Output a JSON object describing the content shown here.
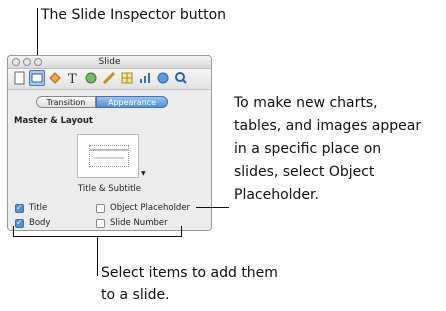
{
  "callouts": {
    "inspector_button": "The Slide Inspector button",
    "object_placeholder": [
      "To make new charts,",
      "tables, and images appear",
      "in a specific place on",
      "slides, select Object",
      "Placeholder."
    ],
    "select_items": [
      "Select items to add them",
      "to a slide."
    ]
  },
  "window": {
    "title": "Slide",
    "toolbar_icons": [
      "document-icon",
      "slide-icon",
      "build-icon",
      "text-icon",
      "graphic-icon",
      "metrics-icon",
      "table-icon",
      "chart-icon",
      "hyperlink-icon",
      "quicktime-icon"
    ],
    "selected_icon": "slide-icon"
  },
  "tabs": {
    "transition": "Transition",
    "appearance": "Appearance"
  },
  "section_title": "Master & Layout",
  "master_name": "Title & Subtitle",
  "thumbnail_text": "Title Here",
  "options": {
    "title": {
      "label": "Title",
      "checked": true
    },
    "body": {
      "label": "Body",
      "checked": true
    },
    "object_placeholder": {
      "label": "Object Placeholder",
      "checked": false
    },
    "slide_number": {
      "label": "Slide Number",
      "checked": false
    }
  },
  "colors": {
    "accent": "#4f8fdc",
    "selected_icon_bg": "#aac3e6"
  }
}
